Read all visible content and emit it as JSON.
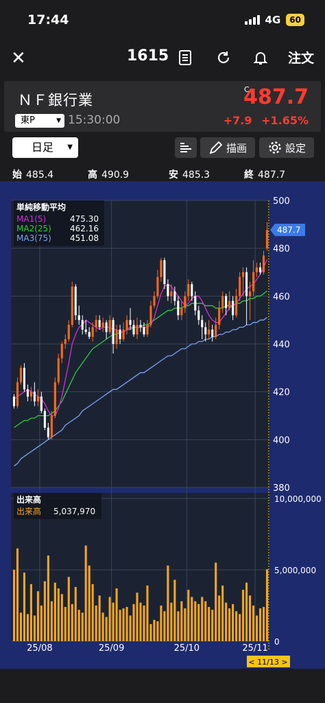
{
  "status": {
    "time": "17:44",
    "network": "4G",
    "battery": "60"
  },
  "nav": {
    "title": "1615",
    "order_label": "注文"
  },
  "quote": {
    "name": "ＮＦ銀行業",
    "market": "東P",
    "time": "15:30:00",
    "c_mark": "C",
    "price": "487.7",
    "change": "+7.9",
    "change_pct": "+1.65%"
  },
  "toolbar": {
    "period": "日足",
    "draw_label": "描画",
    "settings_label": "設定"
  },
  "ohlc": {
    "open_label": "始",
    "open": "485.4",
    "high_label": "高",
    "high": "490.9",
    "low_label": "安",
    "low": "485.3",
    "close_label": "終",
    "close": "487.7"
  },
  "colors": {
    "up": "#ff6a13",
    "down": "#ffffff",
    "ma1": "#d62ed6",
    "ma2": "#2ecc40",
    "ma3": "#7fa2f0",
    "volume": "#f5a623",
    "chart_bg": "#1b2333",
    "panel_bg": "#1e2a6e"
  },
  "ma_legend": {
    "title": "単純移動平均",
    "items": [
      {
        "label": "MA1(5)",
        "value": "475.30"
      },
      {
        "label": "MA2(25)",
        "value": "462.16"
      },
      {
        "label": "MA3(75)",
        "value": "451.08"
      }
    ]
  },
  "volume_legend": {
    "title": "出来高",
    "label": "出来高",
    "value": "5,037,970"
  },
  "last_price_tag": "487.7",
  "date_cursor": "< 11/13 >",
  "chart_data": {
    "type": "candlestick",
    "y_ticks": [
      "500",
      "480",
      "460",
      "440",
      "420",
      "400",
      "380"
    ],
    "ylim": [
      380,
      500
    ],
    "x_ticks": [
      "25/08",
      "25/09",
      "25/10",
      "25/11"
    ],
    "volume_ticks": [
      "10,000,000",
      "5,000,000",
      "0"
    ],
    "volume_lim": [
      0,
      10000000
    ],
    "candles": [
      [
        418,
        414,
        419,
        413
      ],
      [
        414,
        424,
        426,
        413
      ],
      [
        424,
        430,
        431,
        423
      ],
      [
        430,
        421,
        432,
        420
      ],
      [
        421,
        418,
        423,
        416
      ],
      [
        418,
        420,
        422,
        416
      ],
      [
        420,
        416,
        424,
        414
      ],
      [
        416,
        418,
        421,
        414
      ],
      [
        418,
        412,
        420,
        411
      ],
      [
        412,
        405,
        413,
        404
      ],
      [
        405,
        401,
        407,
        400
      ],
      [
        401,
        410,
        412,
        400
      ],
      [
        410,
        424,
        426,
        409
      ],
      [
        424,
        434,
        436,
        423
      ],
      [
        434,
        440,
        441,
        432
      ],
      [
        440,
        442,
        444,
        438
      ],
      [
        442,
        448,
        450,
        441
      ],
      [
        448,
        464,
        466,
        447
      ],
      [
        464,
        452,
        465,
        450
      ],
      [
        452,
        450,
        456,
        448
      ],
      [
        450,
        446,
        452,
        444
      ],
      [
        446,
        445,
        450,
        444
      ],
      [
        445,
        443,
        447,
        442
      ],
      [
        443,
        447,
        449,
        441
      ],
      [
        447,
        450,
        452,
        445
      ],
      [
        450,
        447,
        452,
        446
      ],
      [
        447,
        449,
        451,
        445
      ],
      [
        449,
        445,
        450,
        442
      ],
      [
        445,
        450,
        452,
        444
      ],
      [
        450,
        440,
        451,
        436
      ],
      [
        440,
        446,
        448,
        438
      ],
      [
        446,
        442,
        448,
        440
      ],
      [
        442,
        446,
        449,
        441
      ],
      [
        446,
        450,
        452,
        444
      ],
      [
        450,
        448,
        455,
        446
      ],
      [
        448,
        444,
        450,
        443
      ],
      [
        444,
        448,
        451,
        442
      ],
      [
        448,
        447,
        450,
        445
      ],
      [
        447,
        444,
        449,
        443
      ],
      [
        444,
        448,
        450,
        443
      ],
      [
        448,
        456,
        458,
        447
      ],
      [
        456,
        460,
        462,
        455
      ],
      [
        460,
        468,
        471,
        459
      ],
      [
        468,
        475,
        476,
        466
      ],
      [
        475,
        465,
        476,
        463
      ],
      [
        465,
        460,
        467,
        458
      ],
      [
        460,
        462,
        465,
        457
      ],
      [
        462,
        458,
        464,
        456
      ],
      [
        458,
        452,
        460,
        450
      ],
      [
        452,
        455,
        458,
        450
      ],
      [
        455,
        460,
        462,
        453
      ],
      [
        460,
        465,
        467,
        458
      ],
      [
        465,
        460,
        466,
        458
      ],
      [
        460,
        454,
        462,
        452
      ],
      [
        454,
        450,
        456,
        448
      ],
      [
        450,
        447,
        452,
        442
      ],
      [
        447,
        444,
        449,
        441
      ],
      [
        444,
        446,
        450,
        442
      ],
      [
        446,
        443,
        448,
        441
      ],
      [
        443,
        448,
        451,
        442
      ],
      [
        448,
        455,
        458,
        446
      ],
      [
        455,
        460,
        462,
        453
      ],
      [
        460,
        455,
        461,
        452
      ],
      [
        455,
        458,
        462,
        454
      ],
      [
        458,
        452,
        460,
        450
      ],
      [
        452,
        460,
        463,
        451
      ],
      [
        460,
        468,
        470,
        458
      ],
      [
        468,
        470,
        472,
        460
      ],
      [
        470,
        460,
        472,
        448
      ],
      [
        460,
        462,
        466,
        450
      ],
      [
        462,
        470,
        475,
        460
      ],
      [
        470,
        472,
        474,
        468
      ],
      [
        472,
        470,
        474,
        469
      ],
      [
        470,
        477,
        479,
        469
      ],
      [
        480,
        487.7,
        490.9,
        479
      ]
    ],
    "volumes": [
      5000000,
      6500000,
      2000000,
      4800000,
      1900000,
      4000000,
      1800000,
      3500000,
      2500000,
      4200000,
      6000000,
      2800000,
      4100000,
      3700000,
      3300000,
      2400000,
      4500000,
      2600000,
      3800000,
      2200000,
      2000000,
      6700000,
      5300000,
      4000000,
      2500000,
      3200000,
      2000000,
      1700000,
      3100000,
      2700000,
      3700000,
      2200000,
      2300000,
      2400000,
      1800000,
      2600000,
      3400000,
      2700000,
      2500000,
      3900000,
      1200000,
      1500000,
      1400000,
      2500000,
      2100000,
      5300000,
      2700000,
      4300000,
      2100000,
      2800000,
      2300000,
      3600000,
      3100000,
      2800000,
      2600000,
      3100000,
      2800000,
      2400000,
      2200000,
      5500000,
      3200000,
      3900000,
      2700000,
      2300000,
      2600000,
      2100000,
      1900000,
      3600000,
      4100000,
      3200000,
      2500000,
      1800000,
      2300000,
      2400000,
      5037970
    ],
    "ma1": [
      417,
      418,
      419,
      420,
      421,
      420,
      419,
      418,
      417,
      415,
      412,
      410,
      410,
      413,
      418,
      425,
      432,
      440,
      444,
      447,
      448,
      450,
      449,
      448,
      447,
      446,
      447,
      447,
      447,
      446,
      446,
      445,
      445,
      446,
      447,
      447,
      447,
      447,
      447,
      447,
      448,
      451,
      456,
      461,
      464,
      465,
      464,
      462,
      460,
      458,
      456,
      457,
      459,
      460,
      460,
      458,
      455,
      452,
      450,
      449,
      449,
      451,
      453,
      455,
      456,
      457,
      459,
      461,
      463,
      464,
      465,
      467,
      469,
      472,
      475.3
    ],
    "ma2": [
      405,
      406,
      407,
      408,
      408,
      409,
      409,
      410,
      410,
      410,
      410,
      411,
      412,
      414,
      416,
      419,
      422,
      425,
      428,
      430,
      432,
      434,
      436,
      438,
      439,
      440,
      441,
      442,
      443,
      444,
      444,
      445,
      445,
      446,
      446,
      447,
      447,
      447,
      448,
      448,
      449,
      450,
      451,
      452,
      453,
      454,
      454,
      455,
      455,
      455,
      456,
      456,
      457,
      457,
      457,
      457,
      456,
      456,
      456,
      455,
      455,
      455,
      456,
      456,
      456,
      457,
      457,
      458,
      458,
      459,
      459,
      460,
      460,
      461,
      462.16
    ],
    "ma3": [
      389,
      390,
      392,
      393,
      394,
      395,
      396,
      397,
      398,
      399,
      400,
      401,
      402,
      403,
      404,
      406,
      407,
      408,
      409,
      410,
      412,
      413,
      414,
      415,
      416,
      417,
      418,
      419,
      420,
      421,
      421,
      422,
      423,
      424,
      425,
      426,
      427,
      428,
      428,
      429,
      430,
      431,
      432,
      433,
      434,
      435,
      435,
      436,
      437,
      438,
      438,
      439,
      440,
      440,
      441,
      441,
      442,
      442,
      443,
      443,
      444,
      444,
      445,
      445,
      446,
      446,
      447,
      447,
      448,
      448,
      449,
      449,
      450,
      450,
      451.08
    ]
  }
}
